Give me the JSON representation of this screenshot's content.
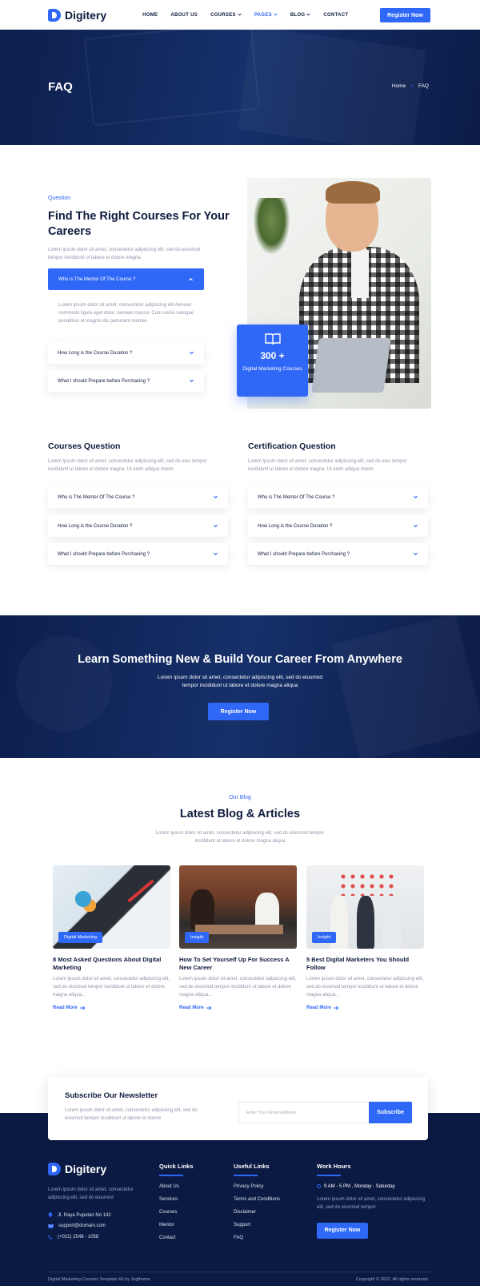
{
  "brand": {
    "name": "Digitery"
  },
  "nav": {
    "items": [
      "HOME",
      "ABOUT US",
      "COURSES",
      "PAGES",
      "BLOG",
      "CONTACT"
    ],
    "register": "Register Now"
  },
  "hero": {
    "title": "FAQ",
    "crumb_home": "Home",
    "crumb_sep": ">",
    "crumb_current": "FAQ"
  },
  "faq": {
    "eyebrow": "Question",
    "title": "Find The Right Courses For Your Careers",
    "intro": "Lorem ipsum dolor sit amet, consectetur adipiscing elit, sed do eiusmod tempor incididunt ut labore et dolore magna",
    "open_question": "Who is The Mentor Of The Course ?",
    "open_answer": "Lorem ipsum dolor sit amet, consectetur adipiscing elit Aenean commodo ligula eget dolor. Aenean massa. Cum sociis natoque penatibus et magnis dis parturient montes",
    "questions": [
      "How Long is the Course Duration ?",
      "What I should Prepare before Purchasing ?"
    ],
    "stat_value": "300 +",
    "stat_label": "Digital Marketing Courses"
  },
  "courses_q": {
    "title": "Courses Question",
    "desc": "Lorem ipsum dolor sit amet, consectetur adipiscing elit, sed do eius tempor incididunt ut labore et dolore magna. Ut enim adiqua minim",
    "questions": [
      "Who is The Mentor Of The Course ?",
      "How Long is the Course Duration ?",
      "What I should Prepare before Purchasing ?"
    ]
  },
  "cert_q": {
    "title": "Certification Question",
    "desc": "Lorem ipsum dolor sit amet, consectetur adipiscing elit, sed do eius tempor incididunt ut labore et dolore magna. Ut enim adiqua minim",
    "questions": [
      "Who is The Mentor Of The Course ?",
      "How Long is the Course Duration ?",
      "What I should Prepare before Purchasing ?"
    ]
  },
  "cta": {
    "title": "Learn Something New & Build Your Career From Anywhere",
    "desc": "Lorem ipsum dolor sit amet, consectetur adipiscing elit, sed do eiusmod tempor incididunt ut labore et dolore magna aliqua",
    "button": "Register Now"
  },
  "blog": {
    "eyebrow": "Our Blog",
    "title": "Latest Blog & Articles",
    "intro": "Lorem ipsum dolor sit amet, consectetur adipiscing elit, sed do eiusmod tempor incididunt ut labore et dolore magna aliqua",
    "posts": [
      {
        "tag": "Digital Marketing",
        "title": "8 Most Asked Questions About Digital Marketing",
        "excerpt": "Lorem ipsum dolor sit amet, consectetur adipiscing elit, sed do eiusmod tempor incididunt ut labore et dolore magna aliqua...",
        "more": "Read More"
      },
      {
        "tag": "Insight",
        "title": "How To Set Yourself Up For Success A New Career",
        "excerpt": "Lorem ipsum dolor sit amet, consectetur adipiscing elit, sed do eiusmod tempor incididunt ut labore et dolore magna aliqua...",
        "more": "Read More"
      },
      {
        "tag": "Insight",
        "title": "5 Best Digital Marketers You Should Follow",
        "excerpt": "Lorem ipsum dolor sit amet, consectetur adipiscing elit, sed do eiusmod tempor incididunt ut labore et dolore magna aliqua...",
        "more": "Read More"
      }
    ]
  },
  "newsletter": {
    "title": "Subscribe Our Newsletter",
    "desc": "Lorem ipsum dolor sit amet, consectetur adipiscing elit, sed do eiusmod tempor incididunt ut labore et dolore",
    "placeholder": "Enter Your Email Address",
    "button": "Subscribe"
  },
  "footer": {
    "about": "Lorem ipsum dolor sit amet, consectetur adipiscing elit, sed do eiusmod",
    "address": "Jl. Raya Puputan No 142",
    "email": "support@domain.com",
    "phone": "(+021) 2548 - 1058",
    "quick_title": "Quick Links",
    "quick_links": [
      "About Us",
      "Services",
      "Courses",
      "Mentor",
      "Contact"
    ],
    "useful_title": "Useful Links",
    "useful_links": [
      "Privacy Policy",
      "Terms and Conditions",
      "Disclaimer",
      "Support",
      "FAQ"
    ],
    "hours_title": "Work Hours",
    "hours": "9 AM - 5 PM , Monday - Saturday",
    "hours_desc": "Lorem ipsum dolor sit amet, consectetur adipiscing elit, sed do eiusmod tempor",
    "button": "Register Now",
    "copy_left": "Digital Marketing Courses Template Kit by Jegtheme",
    "copy_right": "Copyright © 2022. All rights reserved."
  },
  "colors": {
    "accent": "#2f67f6",
    "navy": "#0b1a43",
    "text": "#0f1b3d",
    "muted": "#8f96a8"
  },
  "icons": [
    "logo-icon",
    "chevron-down-icon",
    "chevron-up-icon",
    "book-icon",
    "arrow-right-icon",
    "map-pin-icon",
    "mail-icon",
    "phone-icon",
    "clock-icon"
  ]
}
